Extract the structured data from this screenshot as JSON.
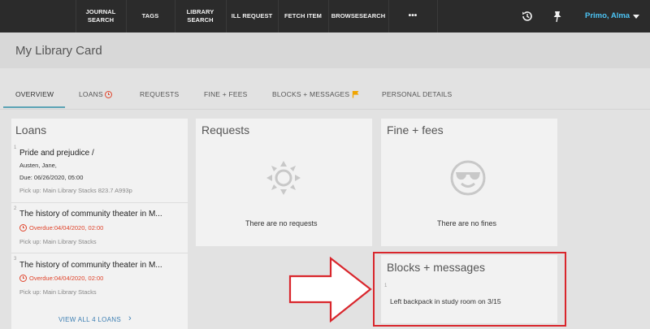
{
  "nav": {
    "items": [
      {
        "line1": "JOURNAL",
        "line2": "SEARCH"
      },
      {
        "line1": "TAGS",
        "line2": ""
      },
      {
        "line1": "LIBRARY",
        "line2": "SEARCH"
      },
      {
        "line1": "ILL REQUEST",
        "line2": ""
      },
      {
        "line1": "FETCH ITEM",
        "line2": ""
      },
      {
        "line1": "BROWSESEARCH",
        "line2": ""
      }
    ],
    "more": "•••",
    "user_name": "Primo, Alma"
  },
  "header": {
    "title": "My Library Card"
  },
  "tabs": {
    "overview": "OVERVIEW",
    "loans": "LOANS",
    "requests": "REQUESTS",
    "fines": "FINE + FEES",
    "blocks": "BLOCKS + MESSAGES",
    "personal": "PERSONAL DETAILS"
  },
  "loans": {
    "title": "Loans",
    "items": [
      {
        "num": "1",
        "title": "Pride and prejudice /",
        "author": "Austen, Jane,",
        "due": "Due: 06/26/2020, 05:00",
        "pickup": "Pick up: Main Library Stacks 823.7 A993p"
      },
      {
        "num": "2",
        "title": "The history of community theater in M...",
        "overdue": "Overdue:04/04/2020, 02:00",
        "pickup": "Pick up: Main Library Stacks"
      },
      {
        "num": "3",
        "title": "The history of community theater in M...",
        "overdue": "Overdue:04/04/2020, 02:00",
        "pickup": "Pick up: Main Library Stacks"
      }
    ],
    "view_all": "VIEW ALL 4 LOANS"
  },
  "requests": {
    "title": "Requests",
    "empty": "There are no requests"
  },
  "fines": {
    "title": "Fine + fees",
    "empty": "There are no fines"
  },
  "blocks": {
    "title": "Blocks + messages",
    "num": "1",
    "message": "Left backpack in study room on 3/15"
  },
  "colors": {
    "nav_bg": "#2b2b2b",
    "user": "#4cc4f5",
    "accent_tab": "#5ba3b5",
    "overdue": "#e0442b",
    "link": "#3d7fb3",
    "highlight": "#d9262c",
    "flag": "#f0a500"
  }
}
